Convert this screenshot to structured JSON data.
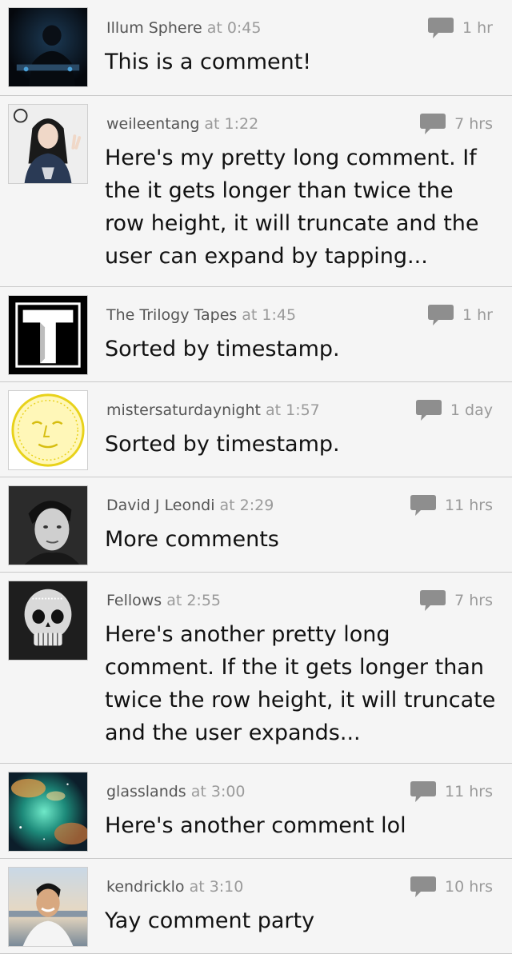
{
  "comments": [
    {
      "user": "Illum Sphere",
      "timestamp": "at 0:45",
      "age": "1 hr",
      "text": "This is a comment!",
      "avatar_icon": "dj-silhouette-avatar"
    },
    {
      "user": "weileentang",
      "timestamp": "at 1:22",
      "age": "7 hrs",
      "text": "Here's my pretty long comment. If the it gets longer than twice the row height, it will truncate and the user can expand by tapping...",
      "avatar_icon": "girl-peace-sign-avatar"
    },
    {
      "user": "The Trilogy Tapes",
      "timestamp": "at 1:45",
      "age": "1 hr",
      "text": "Sorted by timestamp.",
      "avatar_icon": "letter-t-logo-avatar"
    },
    {
      "user": "mistersaturdaynight",
      "timestamp": "at 1:57",
      "age": "1 day",
      "text": "Sorted by timestamp.",
      "avatar_icon": "yellow-moon-face-avatar"
    },
    {
      "user": "David J Leondi",
      "timestamp": "at 2:29",
      "age": "11 hrs",
      "text": "More comments",
      "avatar_icon": "man-portrait-avatar"
    },
    {
      "user": "Fellows",
      "timestamp": "at 2:55",
      "age": "7 hrs",
      "text": "Here's another pretty long comment. If the it gets longer than twice the row height, it will truncate and the user expands...",
      "avatar_icon": "skull-avatar"
    },
    {
      "user": "glasslands",
      "timestamp": "at 3:00",
      "age": "11 hrs",
      "text": "Here's another comment lol",
      "avatar_icon": "nebula-avatar"
    },
    {
      "user": "kendricklo",
      "timestamp": "at 3:10",
      "age": "10 hrs",
      "text": "Yay comment party",
      "avatar_icon": "smiling-man-avatar"
    }
  ],
  "colors": {
    "row_background": "#f5f5f5",
    "divider": "#c9c9c9",
    "username": "#555555",
    "meta_gray": "#9a9a9a",
    "comment_text": "#111111"
  }
}
